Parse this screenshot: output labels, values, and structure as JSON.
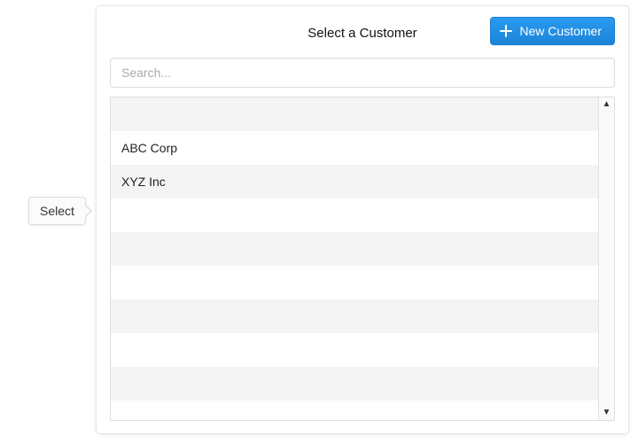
{
  "side_tip": {
    "label": "Select"
  },
  "header": {
    "title": "Select a Customer",
    "new_button_label": "New Customer"
  },
  "search": {
    "placeholder": "Search..."
  },
  "customers": {
    "total_rows_visible": 10,
    "items": [
      {
        "name": ""
      },
      {
        "name": "ABC Corp"
      },
      {
        "name": "XYZ Inc"
      },
      {
        "name": ""
      },
      {
        "name": ""
      },
      {
        "name": ""
      },
      {
        "name": ""
      },
      {
        "name": ""
      },
      {
        "name": ""
      },
      {
        "name": ""
      }
    ]
  }
}
